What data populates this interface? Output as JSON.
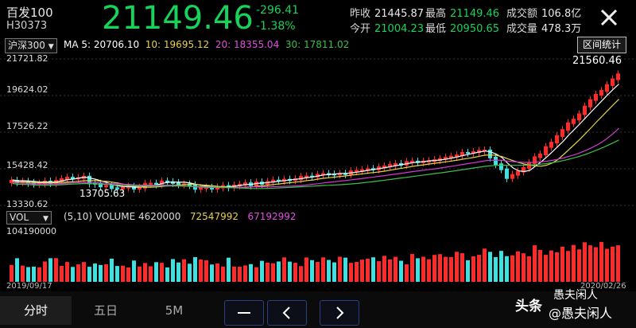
{
  "header": {
    "name": "百发100",
    "code": "H30373",
    "price": "21149.46",
    "change": "-296.41",
    "change_pct": "-1.38%",
    "stats": {
      "prev_close_label": "昨收",
      "prev_close": "21445.87",
      "high_label": "最高",
      "high": "21149.46",
      "turnover_label": "成交额",
      "turnover": "106.8亿",
      "open_label": "今开",
      "open": "21004.23",
      "low_label": "最低",
      "low": "20950.65",
      "volume_label": "成交量",
      "volume": "478.3万"
    }
  },
  "toolbar": {
    "index_select": "沪深300",
    "ma5": "MA 5: 20706.10",
    "ma10": "10: 19695.12",
    "ma20": "20: 18355.04",
    "ma30": "30: 17811.02",
    "range_stats": "区间统计"
  },
  "price_axis": [
    "21721.82",
    "19624.02",
    "17526.22",
    "15428.42",
    "13330.62"
  ],
  "annotations": {
    "peak": "21560.46",
    "low": "13705.63"
  },
  "volume_panel": {
    "indicator": "VOL",
    "params": "(5,10)",
    "volume_label": "VOLUME",
    "volume_value": "4620000",
    "ma5_value": "72547992",
    "ma10_value": "67192992",
    "max_label": "104190000"
  },
  "dates": {
    "start": "2019/09/17",
    "end": "2020/02/26"
  },
  "bottom": {
    "tabs": [
      "分时",
      "五日",
      "5M"
    ],
    "watermark_icon": "头条",
    "watermark_text": "@愚夫闲人",
    "watermark_top": "愚夫闲人"
  },
  "colors": {
    "up": "#ff2a2a",
    "down": "#3ee0e0",
    "ma5": "#ffffff",
    "ma10": "#e6d24a",
    "ma20": "#d23ad2",
    "ma30": "#3fbf4a",
    "price_green": "#18d35a"
  }
}
